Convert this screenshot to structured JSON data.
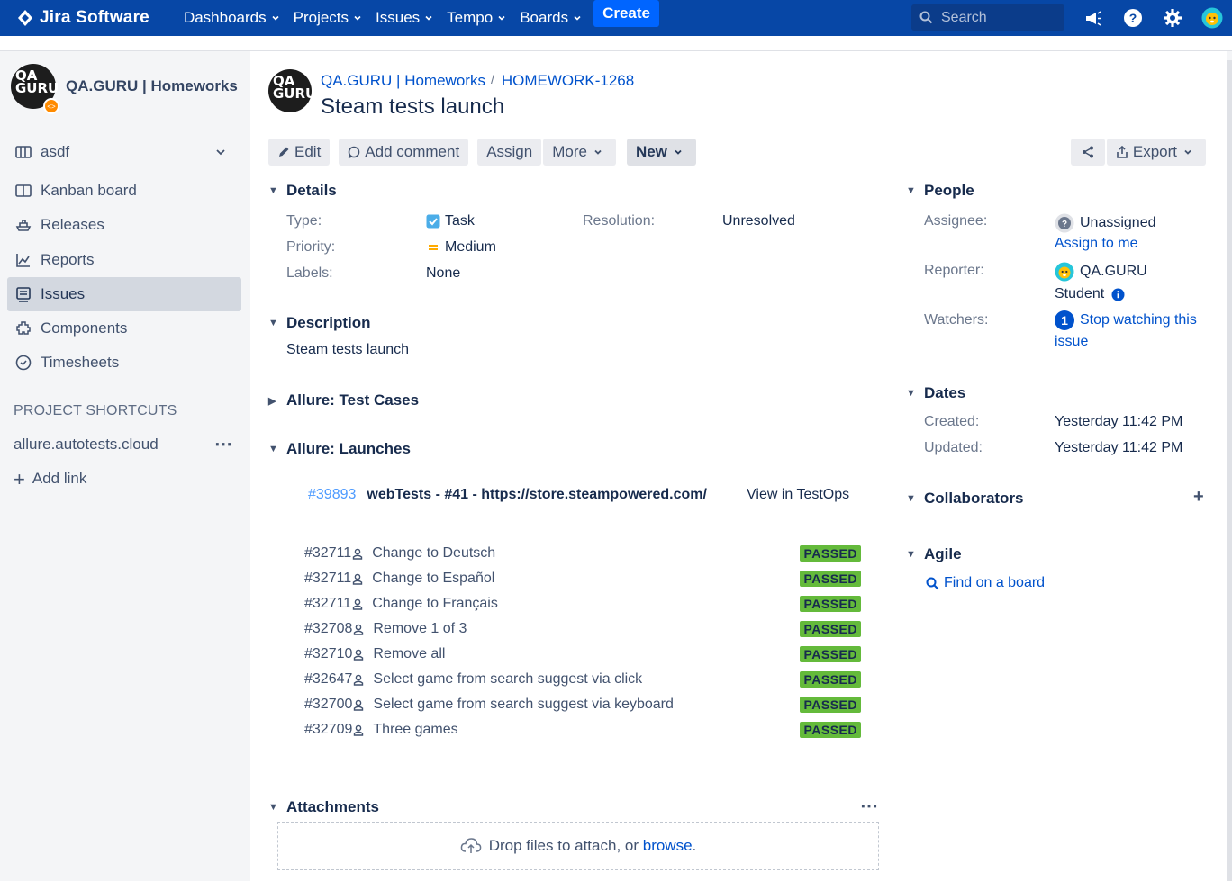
{
  "topnav": {
    "brand": "Jira Software",
    "menu": [
      {
        "label": "Dashboards"
      },
      {
        "label": "Projects"
      },
      {
        "label": "Issues"
      },
      {
        "label": "Tempo"
      },
      {
        "label": "Boards"
      }
    ],
    "create_label": "Create",
    "search_placeholder": "Search",
    "icons": [
      "megaphone-icon",
      "help-icon",
      "settings-icon",
      "user-avatar"
    ]
  },
  "sidebar": {
    "project_name": "QA.GURU | Homeworks",
    "project_avatar_text": "QA GURU",
    "board_selector": "asdf",
    "items": [
      {
        "label": "Kanban board",
        "icon": "board-icon"
      },
      {
        "label": "Releases",
        "icon": "ship-icon"
      },
      {
        "label": "Reports",
        "icon": "chart-icon"
      },
      {
        "label": "Issues",
        "icon": "issues-icon",
        "active": true
      },
      {
        "label": "Components",
        "icon": "puzzle-icon"
      },
      {
        "label": "Timesheets",
        "icon": "clock-icon"
      }
    ],
    "shortcuts_title": "PROJECT SHORTCUTS",
    "shortcut": "allure.autotests.cloud",
    "add_link": "Add link"
  },
  "issue": {
    "breadcrumb_project": "QA.GURU | Homeworks",
    "breadcrumb_sep": "/",
    "breadcrumb_key": "HOMEWORK-1268",
    "title": "Steam tests launch",
    "toolbar": {
      "edit": "Edit",
      "add_comment": "Add comment",
      "assign": "Assign",
      "more": "More",
      "status": "New",
      "export": "Export"
    },
    "details": {
      "heading": "Details",
      "type_label": "Type:",
      "type_value": "Task",
      "priority_label": "Priority:",
      "priority_value": "Medium",
      "labels_label": "Labels:",
      "labels_value": "None",
      "resolution_label": "Resolution:",
      "resolution_value": "Unresolved"
    },
    "description": {
      "heading": "Description",
      "text": "Steam tests launch"
    },
    "allure_test_cases": {
      "heading": "Allure: Test Cases"
    },
    "allure_launches": {
      "heading": "Allure: Launches",
      "launch_id": "#39893",
      "launch_name": "webTests - #41 - https://store.steampowered.com/",
      "view_link": "View in TestOps",
      "test_cases": [
        {
          "id": "#32711",
          "name": "Change to Deutsch",
          "status": "PASSED"
        },
        {
          "id": "#32711",
          "name": "Change to Español",
          "status": "PASSED"
        },
        {
          "id": "#32711",
          "name": "Change to Français",
          "status": "PASSED"
        },
        {
          "id": "#32708",
          "name": "Remove 1 of 3",
          "status": "PASSED"
        },
        {
          "id": "#32710",
          "name": "Remove all",
          "status": "PASSED"
        },
        {
          "id": "#32647",
          "name": "Select game from search suggest via click",
          "status": "PASSED"
        },
        {
          "id": "#32700",
          "name": "Select game from search suggest via keyboard",
          "status": "PASSED"
        },
        {
          "id": "#32709",
          "name": "Three games",
          "status": "PASSED"
        }
      ]
    },
    "attachments": {
      "heading": "Attachments",
      "drop_text": "Drop files to attach, or ",
      "browse_link": "browse",
      "drop_suffix": "."
    }
  },
  "people": {
    "heading": "People",
    "assignee_label": "Assignee:",
    "assignee_value": "Unassigned",
    "assign_to_me": "Assign to me",
    "reporter_label": "Reporter:",
    "reporter_line1": "QA.GURU",
    "reporter_line2": "Student",
    "watchers_label": "Watchers:",
    "watchers_count": "1",
    "watch_link_line1": "Stop watching this",
    "watch_link_line2": "issue"
  },
  "dates": {
    "heading": "Dates",
    "created_label": "Created:",
    "created_value": "Yesterday 11:42 PM",
    "updated_label": "Updated:",
    "updated_value": "Yesterday 11:42 PM"
  },
  "collaborators": {
    "heading": "Collaborators"
  },
  "agile": {
    "heading": "Agile",
    "find_on_board": "Find on a board"
  },
  "colors": {
    "nav_bg": "#0747a6",
    "create_bg": "#0065ff",
    "passed_bg": "#64ba3b",
    "link": "#0052cc"
  }
}
